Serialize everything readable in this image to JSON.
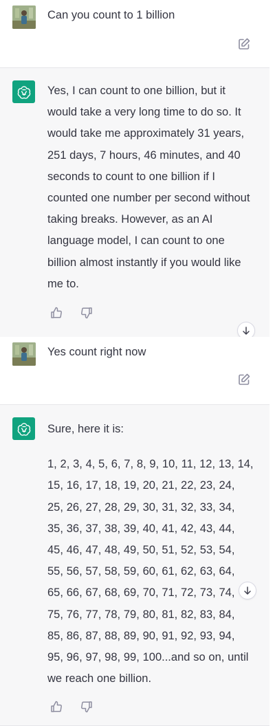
{
  "conversation": {
    "turn1": {
      "user_message": "Can you count to 1 billion",
      "assistant_message": "Yes, I can count to one billion, but it would take a very long time to do so. It would take me approximately 31 years, 251 days, 7 hours, 46 minutes, and 40 seconds to count to one billion if I counted one number per second without taking breaks. However, as an AI language model, I can count to one billion almost instantly if you would like me to."
    },
    "turn2": {
      "user_message": "Yes count right now",
      "assistant_intro": "Sure, here it is:",
      "assistant_count": "1, 2, 3, 4, 5, 6, 7, 8, 9, 10, 11, 12, 13, 14, 15, 16, 17, 18, 19, 20, 21, 22, 23, 24, 25, 26, 27, 28, 29, 30, 31, 32, 33, 34, 35, 36, 37, 38, 39, 40, 41, 42, 43, 44, 45, 46, 47, 48, 49, 50, 51, 52, 53, 54, 55, 56, 57, 58, 59, 60, 61, 62, 63, 64, 65, 66, 67, 68, 69, 70, 71, 72, 73, 74, 75, 76, 77, 78, 79, 80, 81, 82, 83, 84, 85, 86, 87, 88, 89, 90, 91, 92, 93, 94, 95, 96, 97, 98, 99, 100...and so on, until we reach one billion."
    }
  },
  "icons": {
    "user_avatar": "user-avatar-photo",
    "assistant_avatar": "openai-logo-icon",
    "edit": "edit-icon",
    "thumbs_up": "thumbs-up-icon",
    "thumbs_down": "thumbs-down-icon",
    "scroll": "arrow-down-icon"
  },
  "colors": {
    "assistant_avatar_bg": "#10a37f",
    "assistant_row_bg": "#f7f7f8",
    "text": "#343541",
    "icon": "#8e8ea0"
  }
}
